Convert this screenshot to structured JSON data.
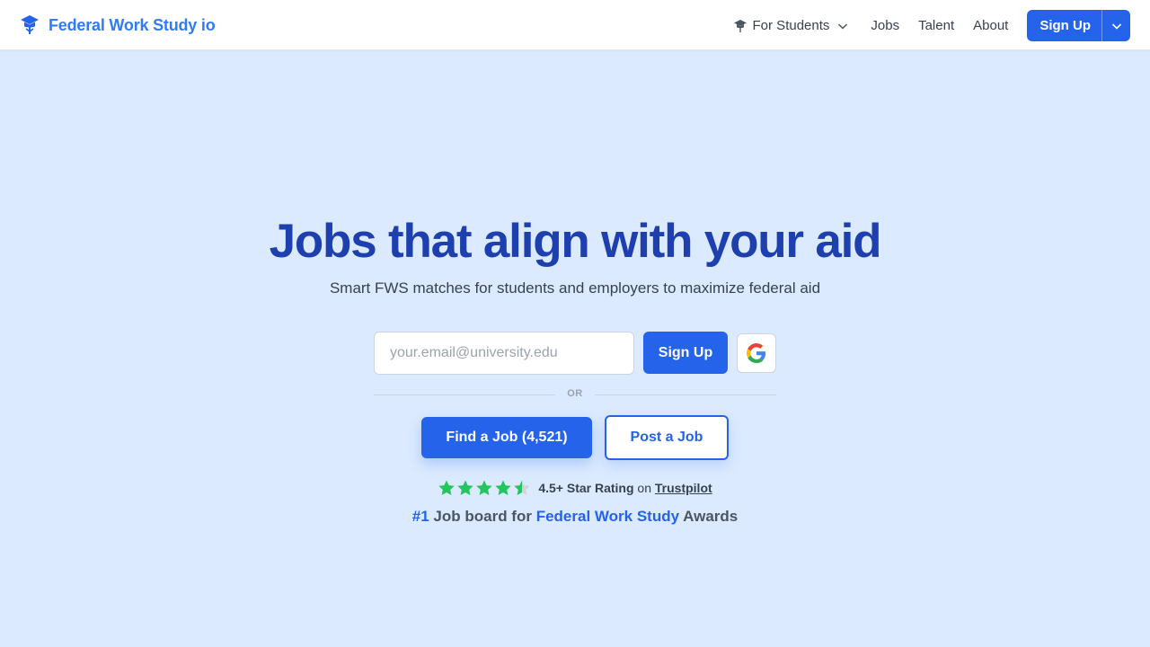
{
  "header": {
    "brand": "Federal Work Study io",
    "brand_icon": "graduation-cap-icon",
    "nav": {
      "for_students": "For Students",
      "jobs": "Jobs",
      "talent": "Talent",
      "about": "About",
      "signup": "Sign Up"
    }
  },
  "hero": {
    "title": "Jobs that align with your aid",
    "subtitle": "Smart FWS matches for students and employers to maximize federal aid",
    "email_placeholder": "your.email@university.edu",
    "signup_label": "Sign Up",
    "google_icon": "google-icon",
    "or_label": "OR",
    "find_job_label": "Find a Job (4,521)",
    "post_job_label": "Post a Job"
  },
  "rating": {
    "stars": 4.5,
    "text": "4.5+ Star Rating",
    "on": "on",
    "link": "Trustpilot"
  },
  "award": {
    "rank": "#1",
    "prefix": "Job board for",
    "highlight": "Federal Work Study",
    "suffix": "Awards"
  },
  "colors": {
    "background": "#dbeafe",
    "primary": "#2563eb",
    "title": "#1e40af",
    "brand": "#2f7cf6",
    "star": "#22c55e"
  }
}
